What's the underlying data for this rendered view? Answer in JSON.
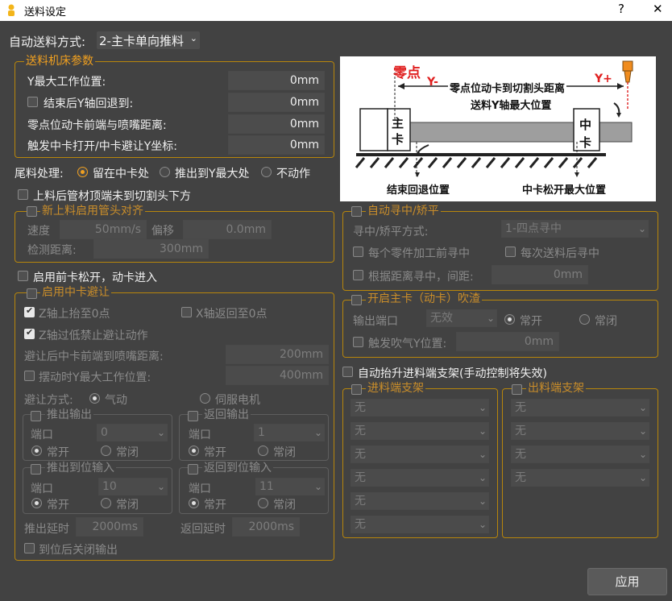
{
  "window": {
    "title": "送料设定",
    "help": "?",
    "close": "✕"
  },
  "mode": {
    "label": "自动送料方式:",
    "value": "2-主卡单向推料"
  },
  "params": {
    "title": "送料机床参数",
    "rows": [
      {
        "label": "Y最大工作位置:",
        "value": "0mm"
      },
      {
        "label": "结束后Y轴回退到:",
        "value": "0mm"
      },
      {
        "label": "零点位动卡前端与喷嘴距离:",
        "value": "0mm"
      },
      {
        "label": "触发中卡打开/中卡避让Y坐标:",
        "value": "0mm"
      }
    ]
  },
  "diagram": {
    "zero": "零点",
    "yminus": "Y-",
    "yplus": "Y+",
    "dist": "零点位动卡到切割头距离",
    "ymax": "送料Y轴最大位置",
    "main1": "主",
    "main2": "卡",
    "mid1": "中",
    "mid2": "卡",
    "end_pos": "结束回退位置",
    "mid_open": "中卡松开最大位置"
  },
  "tail": {
    "label": "尾料处理:",
    "opt1": "留在中卡处",
    "opt2": "推出到Y最大处",
    "opt3": "不动作"
  },
  "top_check": "上料后管材顶端未到切割头下方",
  "newfeed": {
    "title": "新上料启用管头对齐",
    "speed": "速度",
    "speed_val": "50mm/s",
    "offset": "偏移",
    "offset_val": "0.0mm",
    "detect": "检测距离:",
    "detect_val": "300mm"
  },
  "autocenter": {
    "title": "自动寻中/矫平",
    "mode_label": "寻中/矫平方式:",
    "mode_val": "1-四点寻中",
    "c1": "每个零件加工前寻中",
    "c2": "每次送料后寻中",
    "c3": "根据距离寻中，间距:",
    "c3_val": "0mm"
  },
  "front_release": "启用前卡松开，动卡进入",
  "blow": {
    "title": "开启主卡（动卡）吹渣",
    "port": "输出端口",
    "port_val": "无效",
    "open": "常开",
    "close": "常闭",
    "trig": "触发吹气Y位置:",
    "trig_val": "0mm"
  },
  "midavoid": {
    "title": "启用中卡避让",
    "z_up": "Z轴上抬至0点",
    "x_back": "X轴返回至0点",
    "z_low": "Z轴过低禁止避让动作",
    "dist_label": "避让后中卡前端到喷嘴距离:",
    "dist_val": "200mm",
    "swing_label": "摆动时Y最大工作位置:",
    "swing_val": "400mm",
    "mode_label": "避让方式:",
    "mode1": "气动",
    "mode2": "伺服电机",
    "push_out": "推出输出",
    "return_out": "返回输出",
    "push_in": "推出到位输入",
    "return_in": "返回到位输入",
    "port": "端口",
    "open": "常开",
    "close": "常闭",
    "p0": "0",
    "p1": "1",
    "p10": "10",
    "p11": "11",
    "push_delay": "推出延时",
    "push_delay_val": "2000ms",
    "return_delay": "返回延时",
    "return_delay_val": "2000ms",
    "close_out": "到位后关闭输出"
  },
  "auto_lift": "自动抬升进料端支架(手动控制将失效)",
  "infeed": {
    "title": "进料端支架",
    "items": [
      "无",
      "无",
      "无",
      "无",
      "无",
      "无"
    ]
  },
  "outfeed": {
    "title": "出料端支架",
    "items": [
      "无",
      "无",
      "无",
      "无"
    ]
  },
  "apply": "应用"
}
